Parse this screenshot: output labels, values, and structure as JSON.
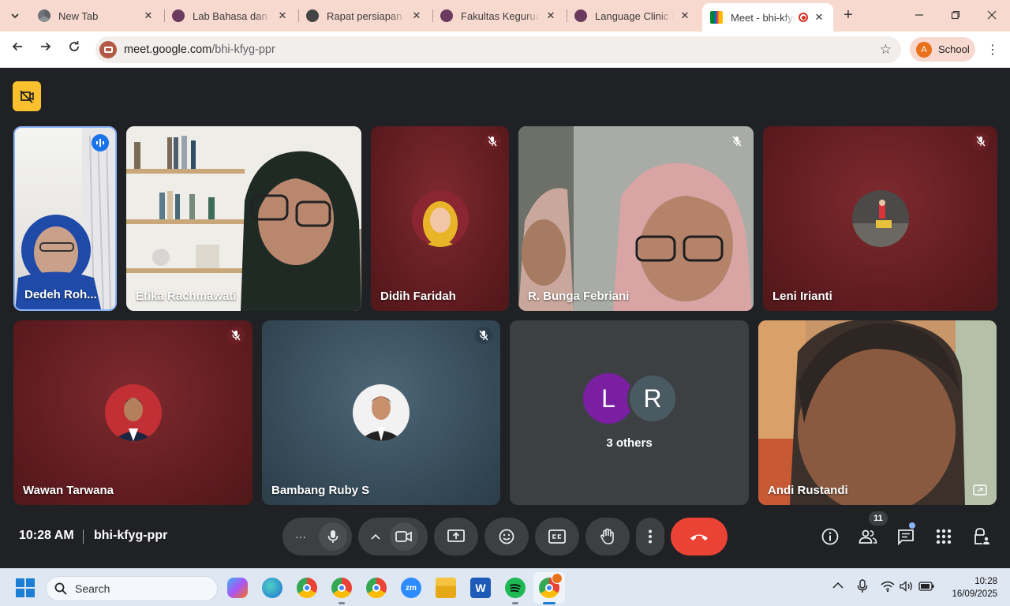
{
  "browser": {
    "tabs": [
      {
        "title": "New Tab",
        "favicon_color": "#5f6368",
        "active": false
      },
      {
        "title": "Lab Bahasa dan Sastra",
        "favicon_color": "#6b3a5e",
        "active": false
      },
      {
        "title": "Rapat persiapan pr",
        "favicon_color": "#444444",
        "active": false
      },
      {
        "title": "Fakultas Keguruan",
        "favicon_color": "#6b3a5e",
        "active": false
      },
      {
        "title": "Language Clinic (K",
        "favicon_color": "#6b3a5e",
        "active": false
      },
      {
        "title": "Meet - bhi-kfyg",
        "favicon_color": "#00832d",
        "active": true
      }
    ],
    "url_host": "meet.google.com",
    "url_path": "/bhi-kfyg-ppr",
    "profile_initial": "A",
    "profile_name": "School"
  },
  "meet": {
    "participants_row1": [
      {
        "name": "Dedeh Roh...",
        "speaking": true
      },
      {
        "name": "Etika Rachmawati",
        "muted": false
      },
      {
        "name": "Didih Faridah",
        "muted": true
      },
      {
        "name": "R. Bunga Febriani",
        "muted": true
      },
      {
        "name": "Leni Irianti",
        "muted": true
      }
    ],
    "participants_row2": [
      {
        "name": "Wawan Tarwana",
        "muted": true
      },
      {
        "name": "Bambang Ruby S",
        "muted": true
      },
      {
        "name": "3 others",
        "initials": [
          "L",
          "R"
        ]
      },
      {
        "name": "Andi Rustandi",
        "muted": false
      }
    ],
    "time": "10:28 AM",
    "meeting_code": "bhi-kfyg-ppr",
    "people_count": "11",
    "colors": {
      "accent_end_call": "#ea4335",
      "stage_bg": "#202124",
      "avatar_L": "#7b1fa2",
      "avatar_R": "#4a5a63"
    }
  },
  "taskbar": {
    "search_label": "Search",
    "time": "10:28",
    "date": "16/09/2025"
  }
}
